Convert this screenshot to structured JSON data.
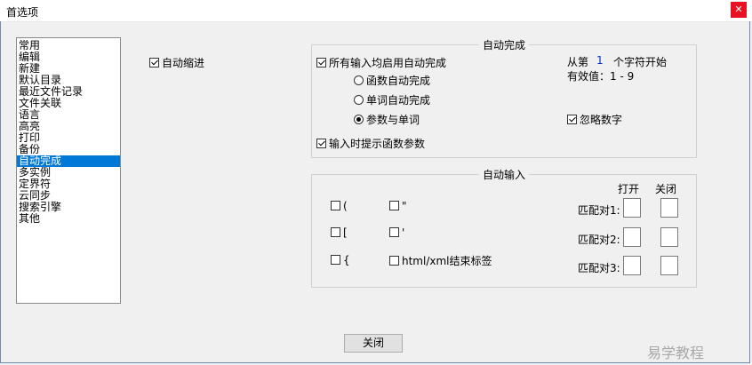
{
  "window": {
    "title": "首选项"
  },
  "categories": [
    "常用",
    "编辑",
    "新建",
    "默认目录",
    "最近文件记录",
    "文件关联",
    "语言",
    "高亮",
    "打印",
    "备份",
    "自动完成",
    "多实例",
    "定界符",
    "云同步",
    "搜索引擎",
    "其他"
  ],
  "selected_category": "自动完成",
  "auto_indent": {
    "label": "自动缩进",
    "checked": true
  },
  "autocomplete": {
    "group_title": "自动完成",
    "enable_all": {
      "label": "所有输入均启用自动完成",
      "checked": true
    },
    "options": [
      {
        "label": "函数自动完成",
        "checked": false
      },
      {
        "label": "单词自动完成",
        "checked": false
      },
      {
        "label": "参数与单词",
        "checked": true
      }
    ],
    "from_prefix": "从第",
    "from_value": "1",
    "from_suffix": "个字符开始",
    "valid_range": "有效值：1 - 9",
    "ignore_numbers": {
      "label": "忽略数字",
      "checked": true
    },
    "hint_params": {
      "label": "输入时提示函数参数",
      "checked": true
    }
  },
  "autoinsert": {
    "group_title": "自动输入",
    "col_open": "打开",
    "col_close": "关闭",
    "items": [
      {
        "label": "(",
        "checked": false
      },
      {
        "label": "\"",
        "checked": false
      },
      {
        "label": "[",
        "checked": false
      },
      {
        "label": "'",
        "checked": false
      },
      {
        "label": "{",
        "checked": false
      },
      {
        "label": "html/xml结束标签",
        "checked": false
      }
    ],
    "match_labels": [
      "匹配对1:",
      "匹配对2:",
      "匹配对3:"
    ]
  },
  "close_button": "关闭",
  "watermark": "易学教程"
}
